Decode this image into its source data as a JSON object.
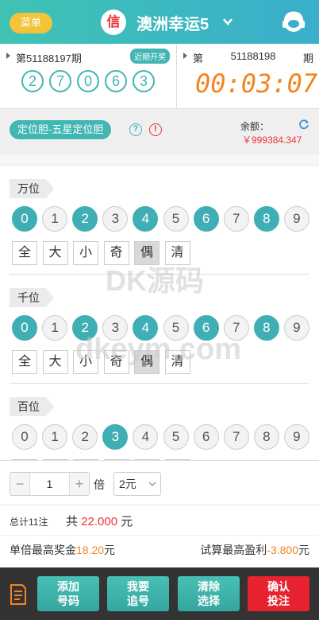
{
  "header": {
    "menu_label": "菜单",
    "logo_char": "信",
    "game_title": "澳洲幸运5"
  },
  "draw": {
    "prev_period": "第51188197期",
    "recent_badge": "近期开奖",
    "result": [
      "2",
      "7",
      "0",
      "6",
      "3"
    ],
    "cur_period_prefix": "第",
    "cur_period_num": "51188198",
    "cur_period_suffix": "期",
    "countdown": "00:03:07"
  },
  "mode": {
    "pill_label": "定位胆-五星定位胆",
    "help_char": "?",
    "warn_char": "!",
    "balance_label": "余额：",
    "balance_value": "￥999384.347"
  },
  "sections": [
    {
      "label": "万位",
      "selected": [
        0,
        2,
        4,
        6,
        8
      ],
      "quick_selected": "偶"
    },
    {
      "label": "千位",
      "selected": [
        0,
        2,
        4,
        6,
        8
      ],
      "quick_selected": "偶"
    },
    {
      "label": "百位",
      "selected": [
        3
      ],
      "quick_selected": ""
    }
  ],
  "digits": [
    "0",
    "1",
    "2",
    "3",
    "4",
    "5",
    "6",
    "7",
    "8",
    "9"
  ],
  "quick_buttons": [
    "全",
    "大",
    "小",
    "奇",
    "偶",
    "清"
  ],
  "bet": {
    "minus": "−",
    "plus": "+",
    "multiple_value": "1",
    "multiple_label": "倍",
    "unit": "2元"
  },
  "totals": {
    "count_text": "总计11注",
    "amount_prefix": "共",
    "amount_value": "22.000",
    "amount_suffix": "元",
    "max_prize_label": "单倍最高奖金",
    "max_prize_value": "18.20",
    "max_prize_suffix": "元",
    "max_profit_label": "试算最高盈利",
    "max_profit_value": "-3.800",
    "max_profit_suffix": "元"
  },
  "footer": {
    "add_label": "添加号码",
    "chase_label": "我要追号",
    "clear_label": "清除选择",
    "confirm_label": "确认投注"
  },
  "watermark": {
    "line1": "DK源码",
    "line2": "dkeym.com"
  },
  "colors": {
    "accent": "#42b6b3",
    "orange": "#f5841f",
    "red": "#e8232f",
    "gold": "#f3c33a"
  }
}
